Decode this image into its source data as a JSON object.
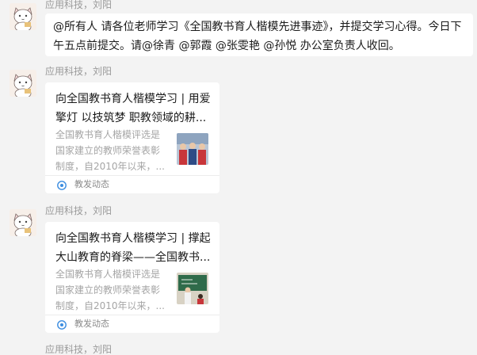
{
  "messages": [
    {
      "sender": "应用科技，刘阳",
      "text_line1": "@所有人 请各位老师学习《全国教书育人楷模先进事迹》，并提交学习心得。今日下",
      "text_line2": "午五点前提交。请@徐青 @郭霞 @张雯艳 @孙悦 办公室负责人收回。"
    },
    {
      "sender": "应用科技，刘阳",
      "card": {
        "title": "向全国教书育人楷模学习 | 用爱擎灯 以技筑梦 职教领域的耕...",
        "description": "全国教书育人楷模评选是国家建立的教师荣誉表彰制度，自2010年以来，...",
        "source": "教发动态"
      }
    },
    {
      "sender": "应用科技，刘阳",
      "card": {
        "title": "向全国教书育人楷模学习 | 撑起大山教育的脊梁——全国教书...",
        "description": "全国教书育人楷模评选是国家建立的教师荣誉表彰制度，自2010年以来，...",
        "source": "教发动态"
      }
    },
    {
      "sender": "应用科技，刘阳"
    }
  ],
  "colors": {
    "background": "#f3f3f3",
    "bubble": "#ffffff",
    "sender_text": "#9a9a9a",
    "source_icon": "#3c8de0"
  }
}
